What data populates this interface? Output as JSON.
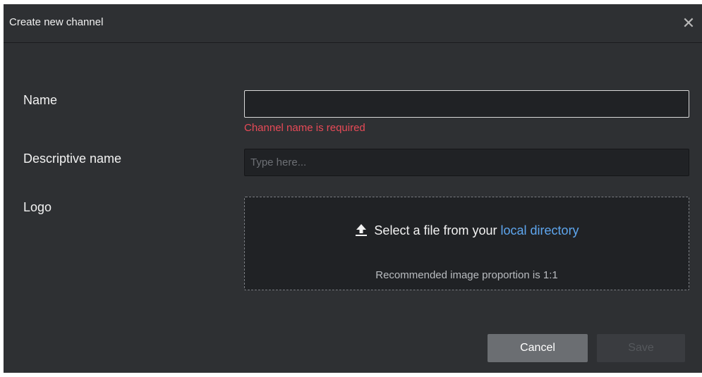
{
  "dialog": {
    "title": "Create new channel",
    "close_icon": "close-icon"
  },
  "form": {
    "name_label": "Name",
    "name_value": "",
    "name_error": "Channel name is required",
    "descriptive_label": "Descriptive name",
    "descriptive_placeholder": "Type here...",
    "logo_label": "Logo",
    "upload_icon": "upload-icon",
    "upload_text": "Select a file from your",
    "upload_link": "local directory",
    "upload_hint": "Recommended image proportion is 1:1"
  },
  "buttons": {
    "cancel": "Cancel",
    "save": "Save"
  },
  "colors": {
    "background": "#2e3033",
    "input_bg": "#202225",
    "error": "#e84a57",
    "link": "#5ea6ee",
    "cancel_bg": "#6b6e72",
    "save_disabled_bg": "#3a3c40"
  }
}
